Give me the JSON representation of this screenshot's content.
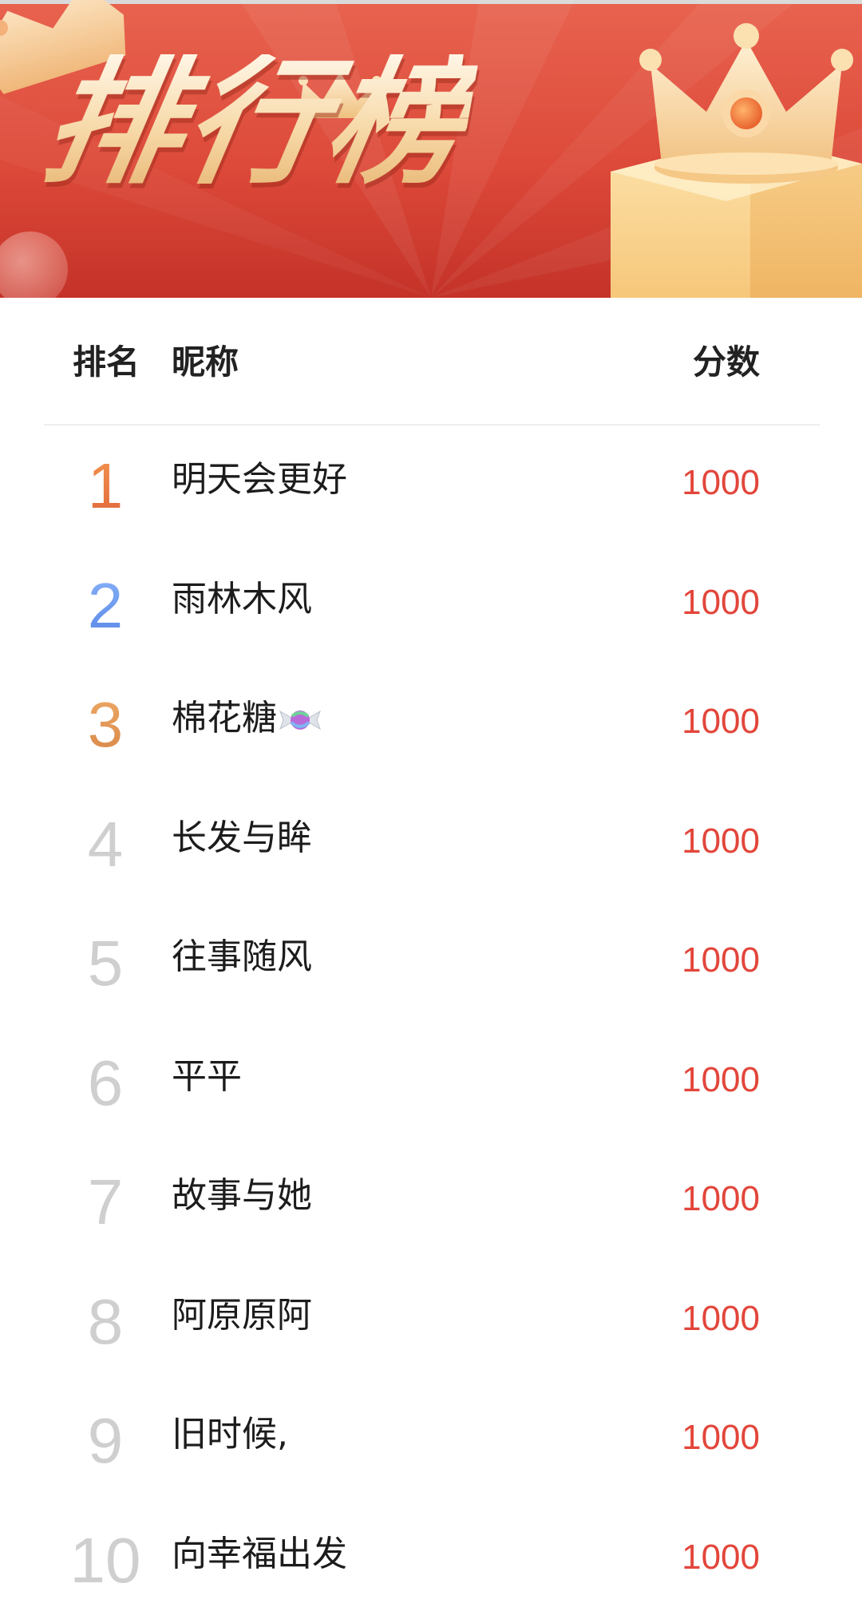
{
  "banner": {
    "title": "排行榜"
  },
  "table": {
    "headers": {
      "rank": "排名",
      "name": "昵称",
      "score": "分数"
    },
    "rows": [
      {
        "rank": "1",
        "name": "明天会更好",
        "score": "1000"
      },
      {
        "rank": "2",
        "name": "雨林木风",
        "score": "1000"
      },
      {
        "rank": "3",
        "name": "棉花糖",
        "score": "1000"
      },
      {
        "rank": "4",
        "name": "长发与眸",
        "score": "1000"
      },
      {
        "rank": "5",
        "name": "往事随风",
        "score": "1000"
      },
      {
        "rank": "6",
        "name": "平平",
        "score": "1000"
      },
      {
        "rank": "7",
        "name": "故事与她",
        "score": "1000"
      },
      {
        "rank": "8",
        "name": "阿原原阿",
        "score": "1000"
      },
      {
        "rank": "9",
        "name": "旧时候,",
        "score": "1000"
      },
      {
        "rank": "10",
        "name": "向幸福出发",
        "score": "1000"
      }
    ]
  },
  "colors": {
    "banner_red": "#dd4a3a",
    "score_red": "#e2463b",
    "rank_gold": "#ec7b45",
    "rank_blue": "#6f9df2",
    "rank_bronze": "#e49a56",
    "rank_gray": "#cfcfcf"
  },
  "icons": {
    "title_crown": "crown-icon",
    "gift_box": "gift-box-icon",
    "candy_emoji": "candy-icon"
  }
}
